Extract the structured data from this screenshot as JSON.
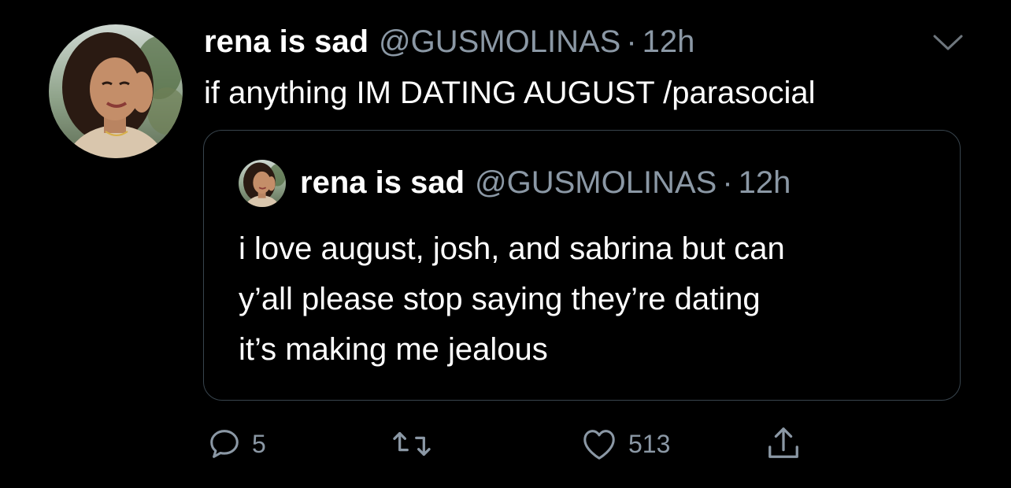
{
  "tweet": {
    "author_name": "rena is sad",
    "author_handle": "@GUSMOLINAS",
    "separator": "·",
    "time": "12h",
    "text": "if anything IM DATING AUGUST /parasocial",
    "avatar_icon": "profile-photo",
    "menu_icon": "chevron-down-icon"
  },
  "quoted_tweet": {
    "author_name": "rena is sad",
    "author_handle": "@GUSMOLINAS",
    "separator": "·",
    "time": "12h",
    "text_lines": [
      "i love august, josh, and sabrina but can",
      "y’all please stop saying they’re dating",
      "it’s making me jealous"
    ]
  },
  "actions": {
    "reply_icon": "reply-icon",
    "reply_count": "5",
    "retweet_icon": "retweet-icon",
    "retweet_count": "",
    "like_icon": "heart-icon",
    "like_count": "513",
    "share_icon": "share-icon"
  },
  "colors": {
    "background": "#000000",
    "text": "#ffffff",
    "secondary": "#8b98a5",
    "border": "#38444d"
  }
}
